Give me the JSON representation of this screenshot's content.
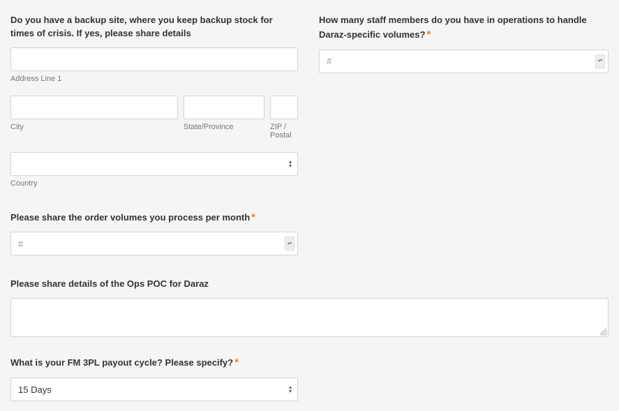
{
  "q_backup": {
    "label": "Do you have a backup site, where you keep backup stock for times of crisis. If yes, please share details",
    "sub_address": "Address Line 1",
    "sub_city": "City",
    "sub_state": "State/Province",
    "sub_zip": "ZIP / Postal",
    "sub_country": "Country"
  },
  "q_staff": {
    "label": "How many staff members do you have in operations to handle Daraz-specific volumes?",
    "placeholder": "#"
  },
  "q_volumes": {
    "label": "Please share the order volumes you process per month",
    "placeholder": "#"
  },
  "q_poc": {
    "label": "Please share details of the Ops POC for Daraz"
  },
  "q_payout": {
    "label": "What is your FM 3PL payout cycle? Please specify?",
    "value": "15 Days"
  }
}
